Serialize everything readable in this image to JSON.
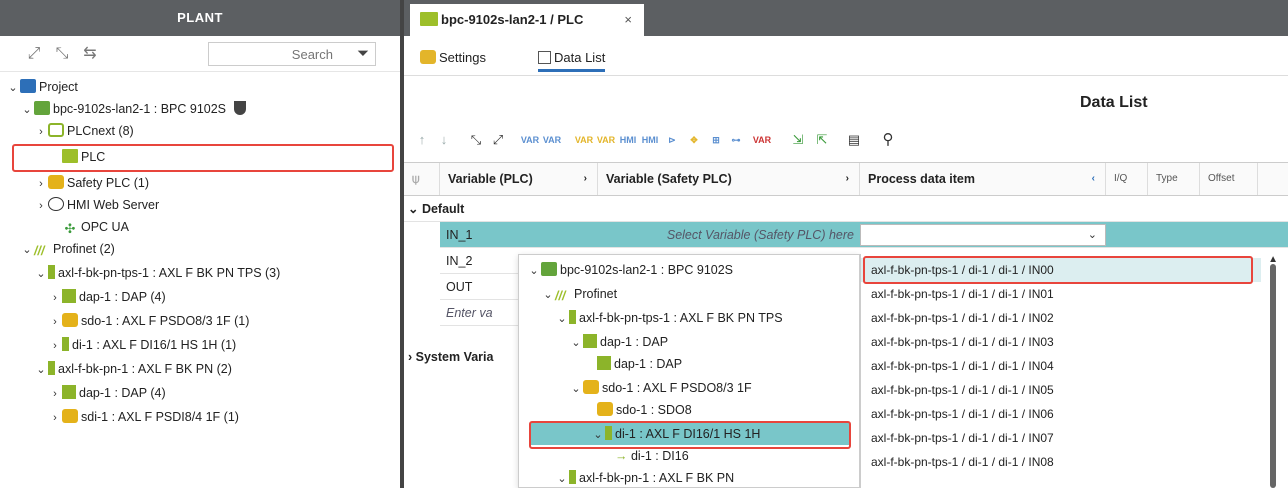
{
  "plant": {
    "title": "PLANT",
    "search_placeholder": "Search",
    "tree": {
      "project": "Project",
      "controller": "bpc-9102s-lan2-1 : BPC 9102S",
      "plcnext": "PLCnext (8)",
      "plc": "PLC",
      "safety_plc": "Safety PLC (1)",
      "hmi": "HMI Web Server",
      "opc": "OPC UA",
      "profinet": "Profinet (2)",
      "bk1": "axl-f-bk-pn-tps-1 : AXL F BK PN TPS (3)",
      "dap1": "dap-1 : DAP (4)",
      "sdo1": "sdo-1 : AXL F PSDO8/3 1F (1)",
      "di1": "di-1 : AXL F DI16/1 HS 1H (1)",
      "bk2": "axl-f-bk-pn-1 : AXL F BK PN (2)",
      "dap2": "dap-1 : DAP (4)",
      "sdi1": "sdi-1 : AXL F PSDI8/4 1F (1)"
    }
  },
  "editor": {
    "tab_title": "bpc-9102s-lan2-1 / PLC",
    "tab_close": "×",
    "subtabs": {
      "settings": "Settings",
      "data_list": "Data List"
    },
    "data_list_title": "Data List",
    "columns": {
      "var_plc": "Variable (PLC)",
      "var_safety": "Variable (Safety PLC)",
      "process": "Process data item",
      "io": "I/Q",
      "type": "Type",
      "offset": "Offset"
    },
    "group_default": "Default",
    "group_system": "System Varia",
    "rows": {
      "r1_name": "IN_1",
      "r1_placeholder": "Select Variable (Safety PLC) here",
      "r2_name": "IN_2",
      "r3_name": "OUT",
      "r4_placeholder": "Enter va"
    }
  },
  "popup_tree": {
    "root": "bpc-9102s-lan2-1 : BPC 9102S",
    "profinet": "Profinet",
    "bk1": "axl-f-bk-pn-tps-1 : AXL F BK PN TPS",
    "dap_parent": "dap-1 : DAP",
    "dap_child": "dap-1 : DAP",
    "sdo_parent": "sdo-1 : AXL F PSDO8/3 1F",
    "sdo_child": "sdo-1 : SDO8",
    "di_parent": "di-1 : AXL F DI16/1 HS 1H",
    "di_child": "di-1 : DI16",
    "bk2": "axl-f-bk-pn-1 : AXL F BK PN"
  },
  "popup_list": {
    "items": [
      "axl-f-bk-pn-tps-1 / di-1 / di-1 / IN00",
      "axl-f-bk-pn-tps-1 / di-1 / di-1 / IN01",
      "axl-f-bk-pn-tps-1 / di-1 / di-1 / IN02",
      "axl-f-bk-pn-tps-1 / di-1 / di-1 / IN03",
      "axl-f-bk-pn-tps-1 / di-1 / di-1 / IN04",
      "axl-f-bk-pn-tps-1 / di-1 / di-1 / IN05",
      "axl-f-bk-pn-tps-1 / di-1 / di-1 / IN06",
      "axl-f-bk-pn-tps-1 / di-1 / di-1 / IN07",
      "axl-f-bk-pn-tps-1 / di-1 / di-1 / IN08"
    ]
  },
  "colors": {
    "header": "#5c5f62",
    "selection": "#79c6c9",
    "highlight": "#e8453c",
    "accent": "#2d6fb8"
  }
}
